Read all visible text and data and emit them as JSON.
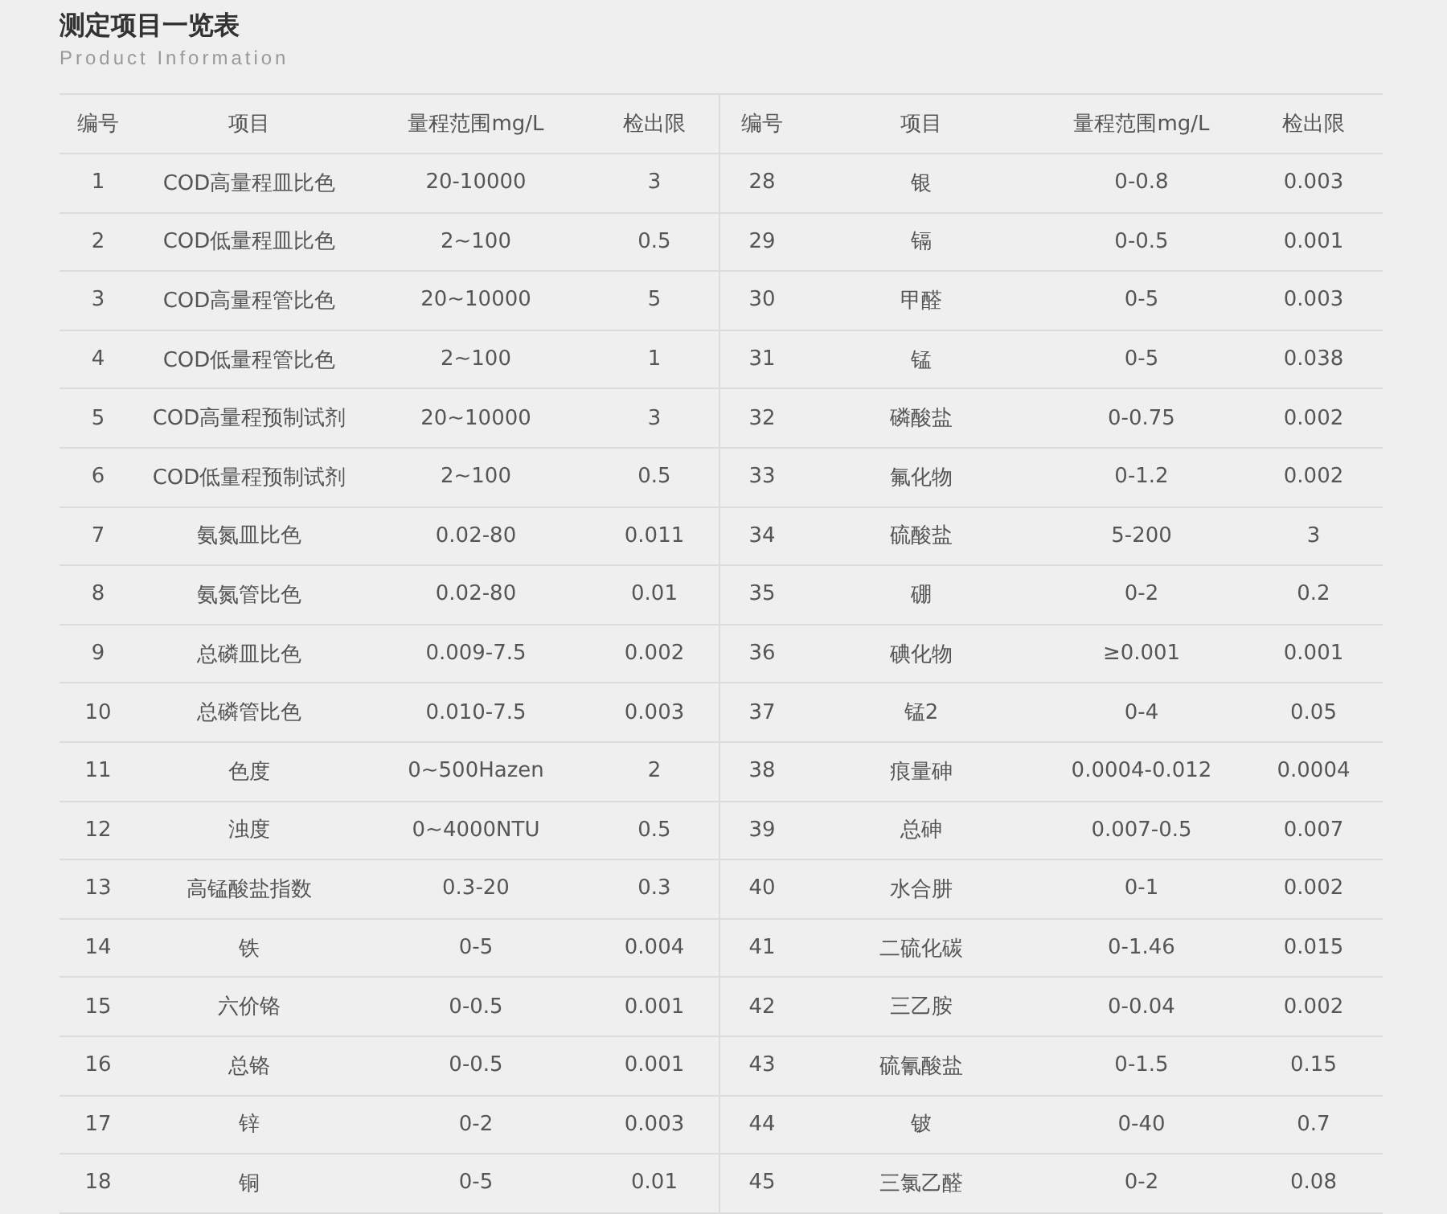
{
  "heading": {
    "title": "测定项目一览表",
    "subtitle": "Product Information"
  },
  "table": {
    "columns": [
      "编号",
      "项目",
      "量程范围mg/L",
      "检出限",
      "编号",
      "项目",
      "量程范围mg/L",
      "检出限"
    ],
    "rows": [
      {
        "cells": [
          "1",
          "COD高量程皿比色",
          "20-10000",
          "3",
          "28",
          "银",
          "0-0.8",
          "0.003"
        ]
      },
      {
        "cells": [
          "2",
          "COD低量程皿比色",
          "2~100",
          "0.5",
          "29",
          "镉",
          "0-0.5",
          "0.001"
        ]
      },
      {
        "cells": [
          "3",
          "COD高量程管比色",
          "20~10000",
          "5",
          "30",
          "甲醛",
          "0-5",
          "0.003"
        ]
      },
      {
        "cells": [
          "4",
          "COD低量程管比色",
          "2~100",
          "1",
          "31",
          "锰",
          "0-5",
          "0.038"
        ]
      },
      {
        "cells": [
          "5",
          "COD高量程预制试剂",
          "20~10000",
          "3",
          "32",
          "磷酸盐",
          "0-0.75",
          "0.002"
        ]
      },
      {
        "cells": [
          "6",
          "COD低量程预制试剂",
          "2~100",
          "0.5",
          "33",
          "氟化物",
          "0-1.2",
          "0.002"
        ]
      },
      {
        "cells": [
          "7",
          "氨氮皿比色",
          "0.02-80",
          "0.011",
          "34",
          "硫酸盐",
          "5-200",
          "3"
        ]
      },
      {
        "cells": [
          "8",
          "氨氮管比色",
          "0.02-80",
          "0.01",
          "35",
          "硼",
          "0-2",
          "0.2"
        ]
      },
      {
        "cells": [
          "9",
          "总磷皿比色",
          "0.009-7.5",
          "0.002",
          "36",
          "碘化物",
          "≥0.001",
          "0.001"
        ]
      },
      {
        "cells": [
          "10",
          "总磷管比色",
          "0.010-7.5",
          "0.003",
          "37",
          "锰2",
          "0-4",
          "0.05"
        ]
      },
      {
        "cells": [
          "11",
          "色度",
          "0~500Hazen",
          "2",
          "38",
          "痕量砷",
          "0.0004-0.012",
          "0.0004"
        ]
      },
      {
        "cells": [
          "12",
          "浊度",
          "0~4000NTU",
          "0.5",
          "39",
          "总砷",
          "0.007-0.5",
          "0.007"
        ]
      },
      {
        "cells": [
          "13",
          "高锰酸盐指数",
          "0.3-20",
          "0.3",
          "40",
          "水合肼",
          "0-1",
          "0.002"
        ]
      },
      {
        "cells": [
          "14",
          "铁",
          "0-5",
          "0.004",
          "41",
          "二硫化碳",
          "0-1.46",
          "0.015"
        ]
      },
      {
        "cells": [
          "15",
          "六价铬",
          "0-0.5",
          "0.001",
          "42",
          "三乙胺",
          "0-0.04",
          "0.002"
        ]
      },
      {
        "cells": [
          "16",
          "总铬",
          "0-0.5",
          "0.001",
          "43",
          "硫氰酸盐",
          "0-1.5",
          "0.15"
        ]
      },
      {
        "cells": [
          "17",
          "锌",
          "0-2",
          "0.003",
          "44",
          "铍",
          "0-40",
          "0.7"
        ]
      },
      {
        "cells": [
          "18",
          "铜",
          "0-5",
          "0.01",
          "45",
          "三氯乙醛",
          "0-2",
          "0.08"
        ]
      }
    ]
  }
}
